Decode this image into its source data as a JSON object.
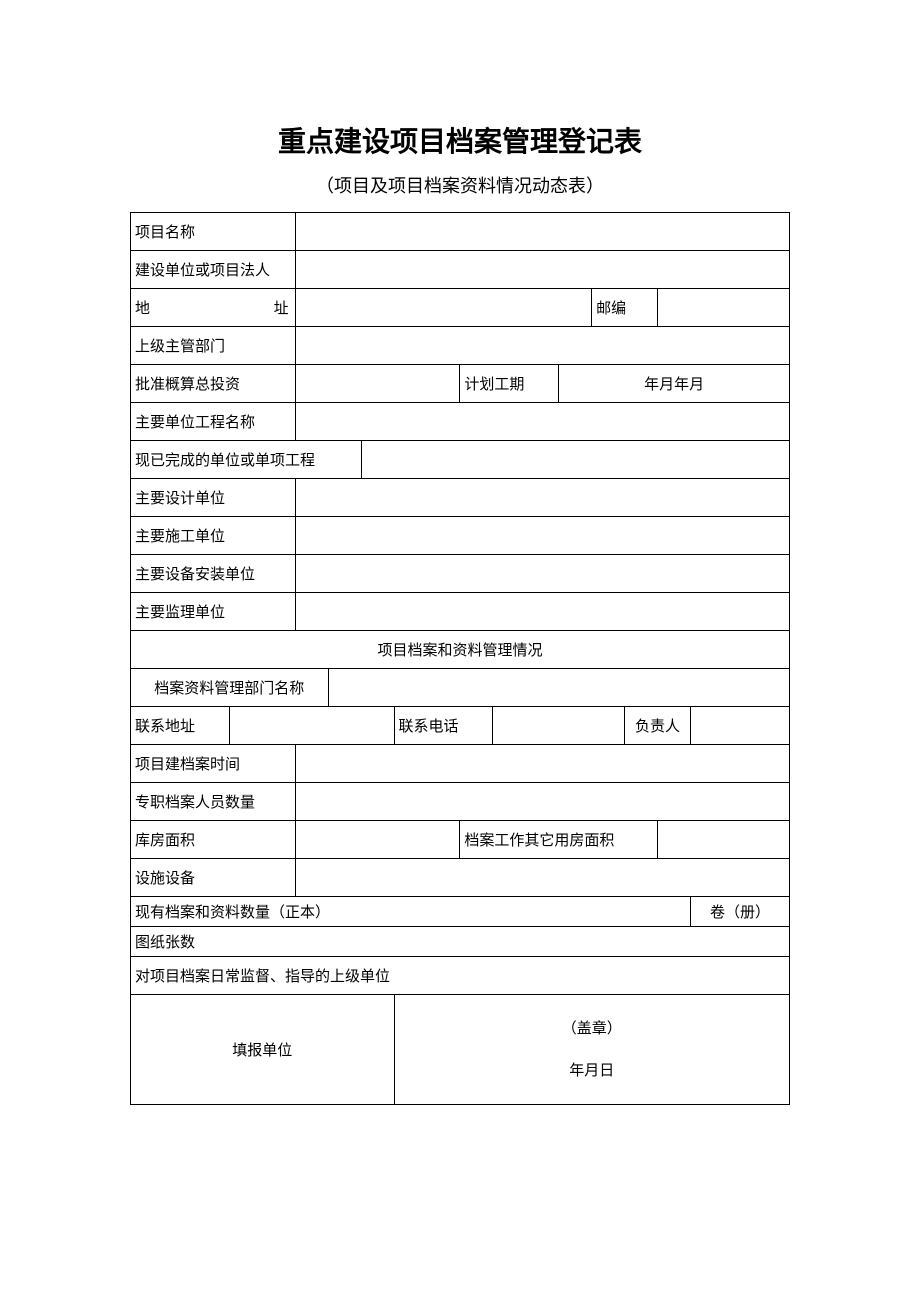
{
  "title": "重点建设项目档案管理登记表",
  "subtitle": "（项目及项目档案资料情况动态表）",
  "labels": {
    "project_name": "项目名称",
    "construction_unit": "建设单位或项目法人",
    "address_zhi": "址",
    "address_di": "地",
    "postcode": "邮编",
    "supervisor_dept": "上级主管部门",
    "approved_investment": "批准概算总投资",
    "planned_duration": "计划工期",
    "planned_duration_format": "年月年月",
    "main_unit_project": "主要单位工程名称",
    "completed_projects": "现已完成的单位或单项工程",
    "main_design_unit": "主要设计单位",
    "main_construction_unit": "主要施工单位",
    "main_equipment_unit": "主要设备安装单位",
    "main_supervision_unit": "主要监理单位",
    "archive_section_header": "项目档案和资料管理情况",
    "archive_dept_name": "档案资料管理部门名称",
    "contact_address": "联系地址",
    "contact_phone": "联系电话",
    "person_in_charge": "负责人",
    "project_archive_time": "项目建档案时间",
    "archive_staff_count": "专职档案人员数量",
    "storage_area": "库房面积",
    "other_room_area": "档案工作其它用房面积",
    "facilities": "设施设备",
    "current_archive_count": "现有档案和资料数量（正本）",
    "volume_unit": "卷（册）",
    "drawing_count": "图纸张数",
    "daily_supervision_unit": "对项目档案日常监督、指导的上级单位",
    "reporting_unit": "填报单位",
    "stamp": "（盖章）",
    "date_format": "年月日"
  }
}
